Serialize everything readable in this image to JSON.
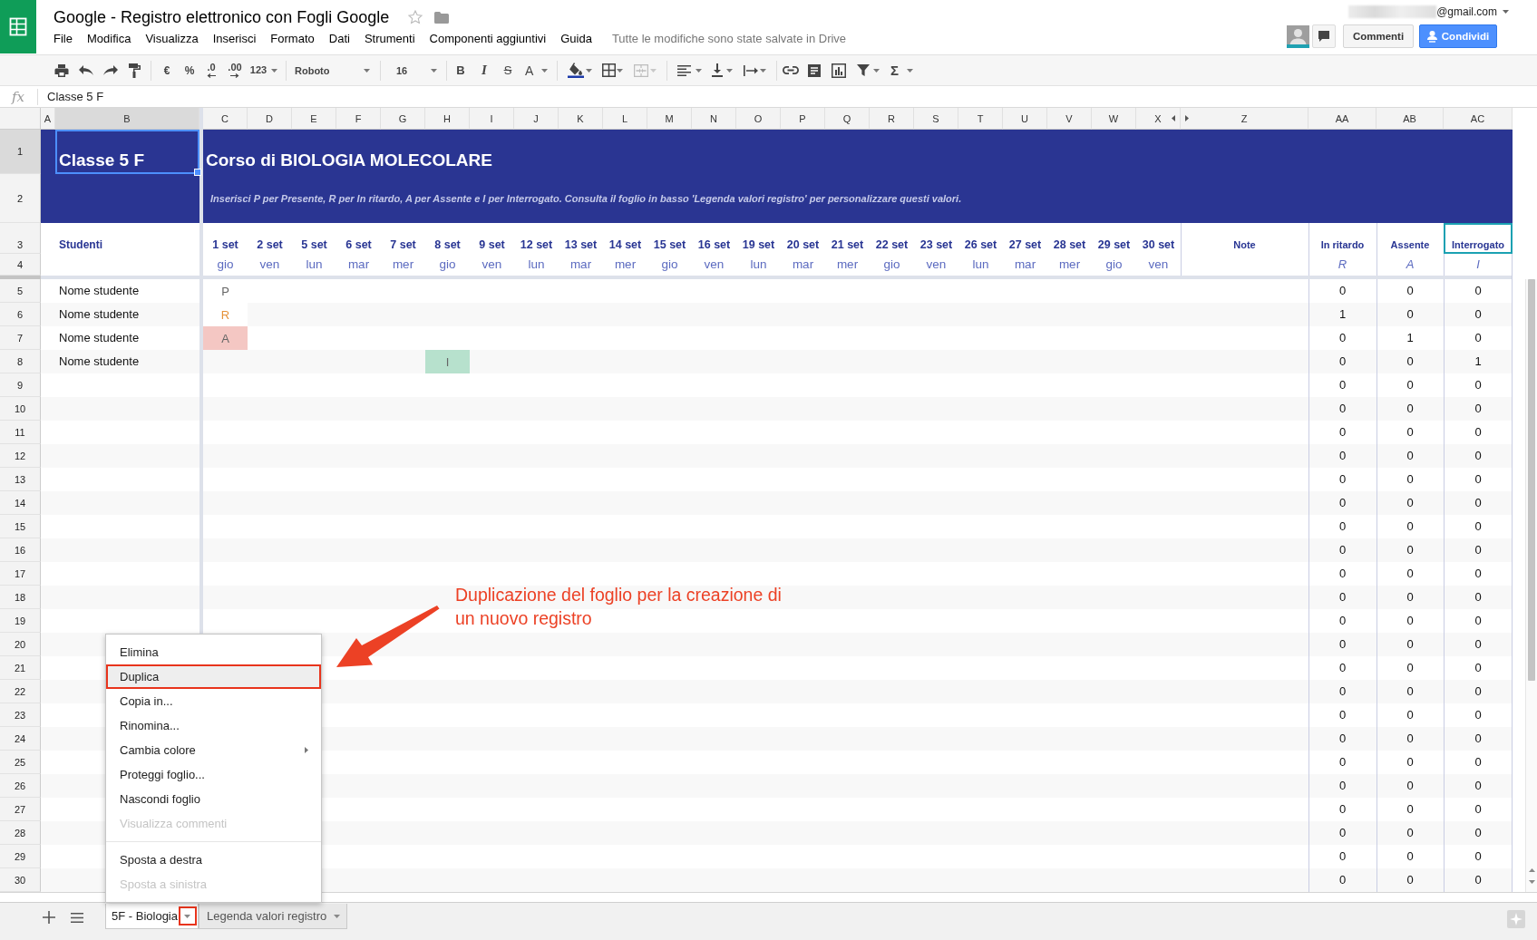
{
  "header": {
    "title": "Google - Registro elettronico con Fogli Google",
    "menu": [
      "File",
      "Modifica",
      "Visualizza",
      "Inserisci",
      "Formato",
      "Dati",
      "Strumenti",
      "Componenti aggiuntivi",
      "Guida"
    ],
    "save_status": "Tutte le modifiche sono state salvate in Drive",
    "account": "@gmail.com",
    "buttons": [
      {
        "label": "Commenti",
        "kind": "plain"
      },
      {
        "label": "Condividi",
        "kind": "share"
      }
    ]
  },
  "toolbar": {
    "number_buttons": [
      {
        "label": "€",
        "kind": "currency"
      },
      {
        "label": "%",
        "kind": "percent"
      },
      {
        "label": ".0",
        "kind": "decrease-decimals"
      },
      {
        "label": ".00",
        "kind": "increase-decimals"
      },
      {
        "label": "123",
        "kind": "more-formats"
      }
    ],
    "font": "Roboto",
    "font_size": "16",
    "style_buttons": [
      {
        "label": "B",
        "kind": "bold"
      },
      {
        "label": "I",
        "kind": "italic"
      },
      {
        "label": "S",
        "kind": "strikethrough"
      },
      {
        "label": "A",
        "kind": "text-color"
      }
    ],
    "merge_cells": {
      "disabled": true
    },
    "functions_button": "Σ"
  },
  "formula_bar": {
    "label": "fx",
    "value": "Classe 5 F"
  },
  "columns": [
    {
      "label": "A",
      "kind": "normal",
      "selected": false
    },
    {
      "label": "B",
      "kind": "normal",
      "selected": true
    },
    {
      "label": "C",
      "kind": "normal",
      "selected": false
    },
    {
      "label": "D",
      "kind": "normal",
      "selected": false
    },
    {
      "label": "E",
      "kind": "normal",
      "selected": false
    },
    {
      "label": "F",
      "kind": "normal",
      "selected": false
    },
    {
      "label": "G",
      "kind": "normal",
      "selected": false
    },
    {
      "label": "H",
      "kind": "normal",
      "selected": false
    },
    {
      "label": "I",
      "kind": "normal",
      "selected": false
    },
    {
      "label": "J",
      "kind": "normal",
      "selected": false
    },
    {
      "label": "K",
      "kind": "normal",
      "selected": false
    },
    {
      "label": "L",
      "kind": "normal",
      "selected": false
    },
    {
      "label": "M",
      "kind": "normal",
      "selected": false
    },
    {
      "label": "N",
      "kind": "normal",
      "selected": false
    },
    {
      "label": "O",
      "kind": "normal",
      "selected": false
    },
    {
      "label": "P",
      "kind": "normal",
      "selected": false
    },
    {
      "label": "Q",
      "kind": "normal",
      "selected": false
    },
    {
      "label": "R",
      "kind": "normal",
      "selected": false
    },
    {
      "label": "S",
      "kind": "normal",
      "selected": false
    },
    {
      "label": "T",
      "kind": "normal",
      "selected": false
    },
    {
      "label": "U",
      "kind": "normal",
      "selected": false
    },
    {
      "label": "V",
      "kind": "normal",
      "selected": false
    },
    {
      "label": "W",
      "kind": "normal",
      "selected": false
    },
    {
      "label": "X",
      "kind": "before-hidden",
      "selected": false
    },
    {
      "label": "Z",
      "kind": "after-hidden",
      "selected": false
    },
    {
      "label": "AA",
      "kind": "normal",
      "selected": false
    },
    {
      "label": "AB",
      "kind": "normal",
      "selected": false
    },
    {
      "label": "AC",
      "kind": "normal",
      "selected": false
    }
  ],
  "sheet": {
    "title_rows": [
      {
        "number": "1",
        "selected": true
      },
      {
        "number": "2",
        "selected": false
      },
      {
        "number": "3",
        "selected": false
      },
      {
        "number": "4",
        "selected": false
      }
    ],
    "class_cell": {
      "text": "Classe 5 F",
      "selected": true
    },
    "course_title": "Corso di BIOLOGIA MOLECOLARE",
    "instructions": "Inserisci P per Presente, R per In ritardo, A per Assente e I per Interrogato. Consulta il foglio in basso 'Legenda valori registro' per personalizzare questi valori.",
    "students_heading": "Studenti",
    "dates": [
      {
        "day": "1 set",
        "weekday": "gio"
      },
      {
        "day": "2 set",
        "weekday": "ven"
      },
      {
        "day": "5 set",
        "weekday": "lun"
      },
      {
        "day": "6 set",
        "weekday": "mar"
      },
      {
        "day": "7 set",
        "weekday": "mer"
      },
      {
        "day": "8 set",
        "weekday": "gio"
      },
      {
        "day": "9 set",
        "weekday": "ven"
      },
      {
        "day": "12 set",
        "weekday": "lun"
      },
      {
        "day": "13 set",
        "weekday": "mar"
      },
      {
        "day": "14 set",
        "weekday": "mer"
      },
      {
        "day": "15 set",
        "weekday": "gio"
      },
      {
        "day": "16 set",
        "weekday": "ven"
      },
      {
        "day": "19 set",
        "weekday": "lun"
      },
      {
        "day": "20 set",
        "weekday": "mar"
      },
      {
        "day": "21 set",
        "weekday": "mer"
      },
      {
        "day": "22 set",
        "weekday": "gio"
      },
      {
        "day": "23 set",
        "weekday": "ven"
      },
      {
        "day": "26 set",
        "weekday": "lun"
      },
      {
        "day": "27 set",
        "weekday": "mar"
      },
      {
        "day": "28 set",
        "weekday": "mer"
      },
      {
        "day": "29 set",
        "weekday": "gio"
      },
      {
        "day": "30 set",
        "weekday": "ven"
      }
    ],
    "notes_heading": "Note",
    "tallies": [
      {
        "label": "In ritardo",
        "code": "R",
        "collaborator_cursor": false
      },
      {
        "label": "Assente",
        "code": "A",
        "collaborator_cursor": false
      },
      {
        "label": "Interrogato",
        "code": "I",
        "collaborator_cursor": true
      }
    ]
  },
  "rows": [
    {
      "number": "5",
      "selected": false,
      "student": "Nome studente",
      "attendance": [
        {
          "value": "P",
          "kind": "present"
        }
      ],
      "tallies": [
        "0",
        "0",
        "0"
      ]
    },
    {
      "number": "6",
      "selected": false,
      "student": "Nome studente",
      "attendance": [
        {
          "value": "R",
          "kind": "late"
        }
      ],
      "tallies": [
        "1",
        "0",
        "0"
      ]
    },
    {
      "number": "7",
      "selected": false,
      "student": "Nome studente",
      "attendance": [
        {
          "value": "A",
          "kind": "absent"
        }
      ],
      "tallies": [
        "0",
        "1",
        "0"
      ]
    },
    {
      "number": "8",
      "selected": false,
      "student": "Nome studente",
      "attendance": [
        {
          "kind": "blank"
        },
        {
          "kind": "blank"
        },
        {
          "kind": "blank"
        },
        {
          "kind": "blank"
        },
        {
          "kind": "blank"
        },
        {
          "value": "I",
          "kind": "interrogated"
        }
      ],
      "tallies": [
        "0",
        "0",
        "1"
      ]
    },
    {
      "number": "9",
      "selected": false,
      "tallies": [
        "0",
        "0",
        "0"
      ]
    },
    {
      "number": "10",
      "selected": false,
      "tallies": [
        "0",
        "0",
        "0"
      ]
    },
    {
      "number": "11",
      "selected": false,
      "tallies": [
        "0",
        "0",
        "0"
      ]
    },
    {
      "number": "12",
      "selected": false,
      "tallies": [
        "0",
        "0",
        "0"
      ]
    },
    {
      "number": "13",
      "selected": false,
      "tallies": [
        "0",
        "0",
        "0"
      ]
    },
    {
      "number": "14",
      "selected": false,
      "tallies": [
        "0",
        "0",
        "0"
      ]
    },
    {
      "number": "15",
      "selected": false,
      "tallies": [
        "0",
        "0",
        "0"
      ]
    },
    {
      "number": "16",
      "selected": false,
      "tallies": [
        "0",
        "0",
        "0"
      ]
    },
    {
      "number": "17",
      "selected": false,
      "tallies": [
        "0",
        "0",
        "0"
      ]
    },
    {
      "number": "18",
      "selected": false,
      "tallies": [
        "0",
        "0",
        "0"
      ]
    },
    {
      "number": "19",
      "selected": false,
      "tallies": [
        "0",
        "0",
        "0"
      ]
    },
    {
      "number": "20",
      "selected": false,
      "tallies": [
        "0",
        "0",
        "0"
      ]
    },
    {
      "number": "21",
      "selected": false,
      "tallies": [
        "0",
        "0",
        "0"
      ]
    },
    {
      "number": "22",
      "selected": false,
      "tallies": [
        "0",
        "0",
        "0"
      ]
    },
    {
      "number": "23",
      "selected": false,
      "tallies": [
        "0",
        "0",
        "0"
      ]
    },
    {
      "number": "24",
      "selected": false,
      "tallies": [
        "0",
        "0",
        "0"
      ]
    },
    {
      "number": "25",
      "selected": false,
      "tallies": [
        "0",
        "0",
        "0"
      ]
    },
    {
      "number": "26",
      "selected": false,
      "tallies": [
        "0",
        "0",
        "0"
      ]
    },
    {
      "number": "27",
      "selected": false,
      "tallies": [
        "0",
        "0",
        "0"
      ]
    },
    {
      "number": "28",
      "selected": false,
      "tallies": [
        "0",
        "0",
        "0"
      ]
    },
    {
      "number": "29",
      "selected": false,
      "tallies": [
        "0",
        "0",
        "0"
      ]
    },
    {
      "number": "30",
      "selected": false,
      "tallies": [
        "0",
        "0",
        "0"
      ]
    }
  ],
  "sheet_tabs": [
    {
      "label": "5F - Biologia",
      "selected": true,
      "callout": true
    },
    {
      "label": "Legenda valori registro",
      "selected": false,
      "callout": false
    }
  ],
  "tab_menu": {
    "sections": [
      {
        "items": [
          {
            "label": "Elimina",
            "selected": false,
            "disabled": false,
            "submenu": false,
            "callout": false
          },
          {
            "label": "Duplica",
            "selected": true,
            "disabled": false,
            "submenu": false,
            "callout": true
          },
          {
            "label": "Copia in...",
            "selected": false,
            "disabled": false,
            "submenu": false,
            "callout": false
          },
          {
            "label": "Rinomina...",
            "selected": false,
            "disabled": false,
            "submenu": false,
            "callout": false
          },
          {
            "label": "Cambia colore",
            "selected": false,
            "disabled": false,
            "submenu": true,
            "callout": false
          },
          {
            "label": "Proteggi foglio...",
            "selected": false,
            "disabled": false,
            "submenu": false,
            "callout": false
          },
          {
            "label": "Nascondi foglio",
            "selected": false,
            "disabled": false,
            "submenu": false,
            "callout": false
          },
          {
            "label": "Visualizza commenti",
            "selected": false,
            "disabled": true,
            "submenu": false,
            "callout": false
          }
        ]
      },
      {
        "items": [
          {
            "label": "Sposta a destra",
            "selected": false,
            "disabled": false,
            "submenu": false,
            "callout": false
          },
          {
            "label": "Sposta a sinistra",
            "selected": false,
            "disabled": true,
            "submenu": false,
            "callout": false
          }
        ]
      }
    ]
  },
  "annotation": {
    "text": "Duplicazione del foglio per la creazione di un nuovo registro"
  }
}
